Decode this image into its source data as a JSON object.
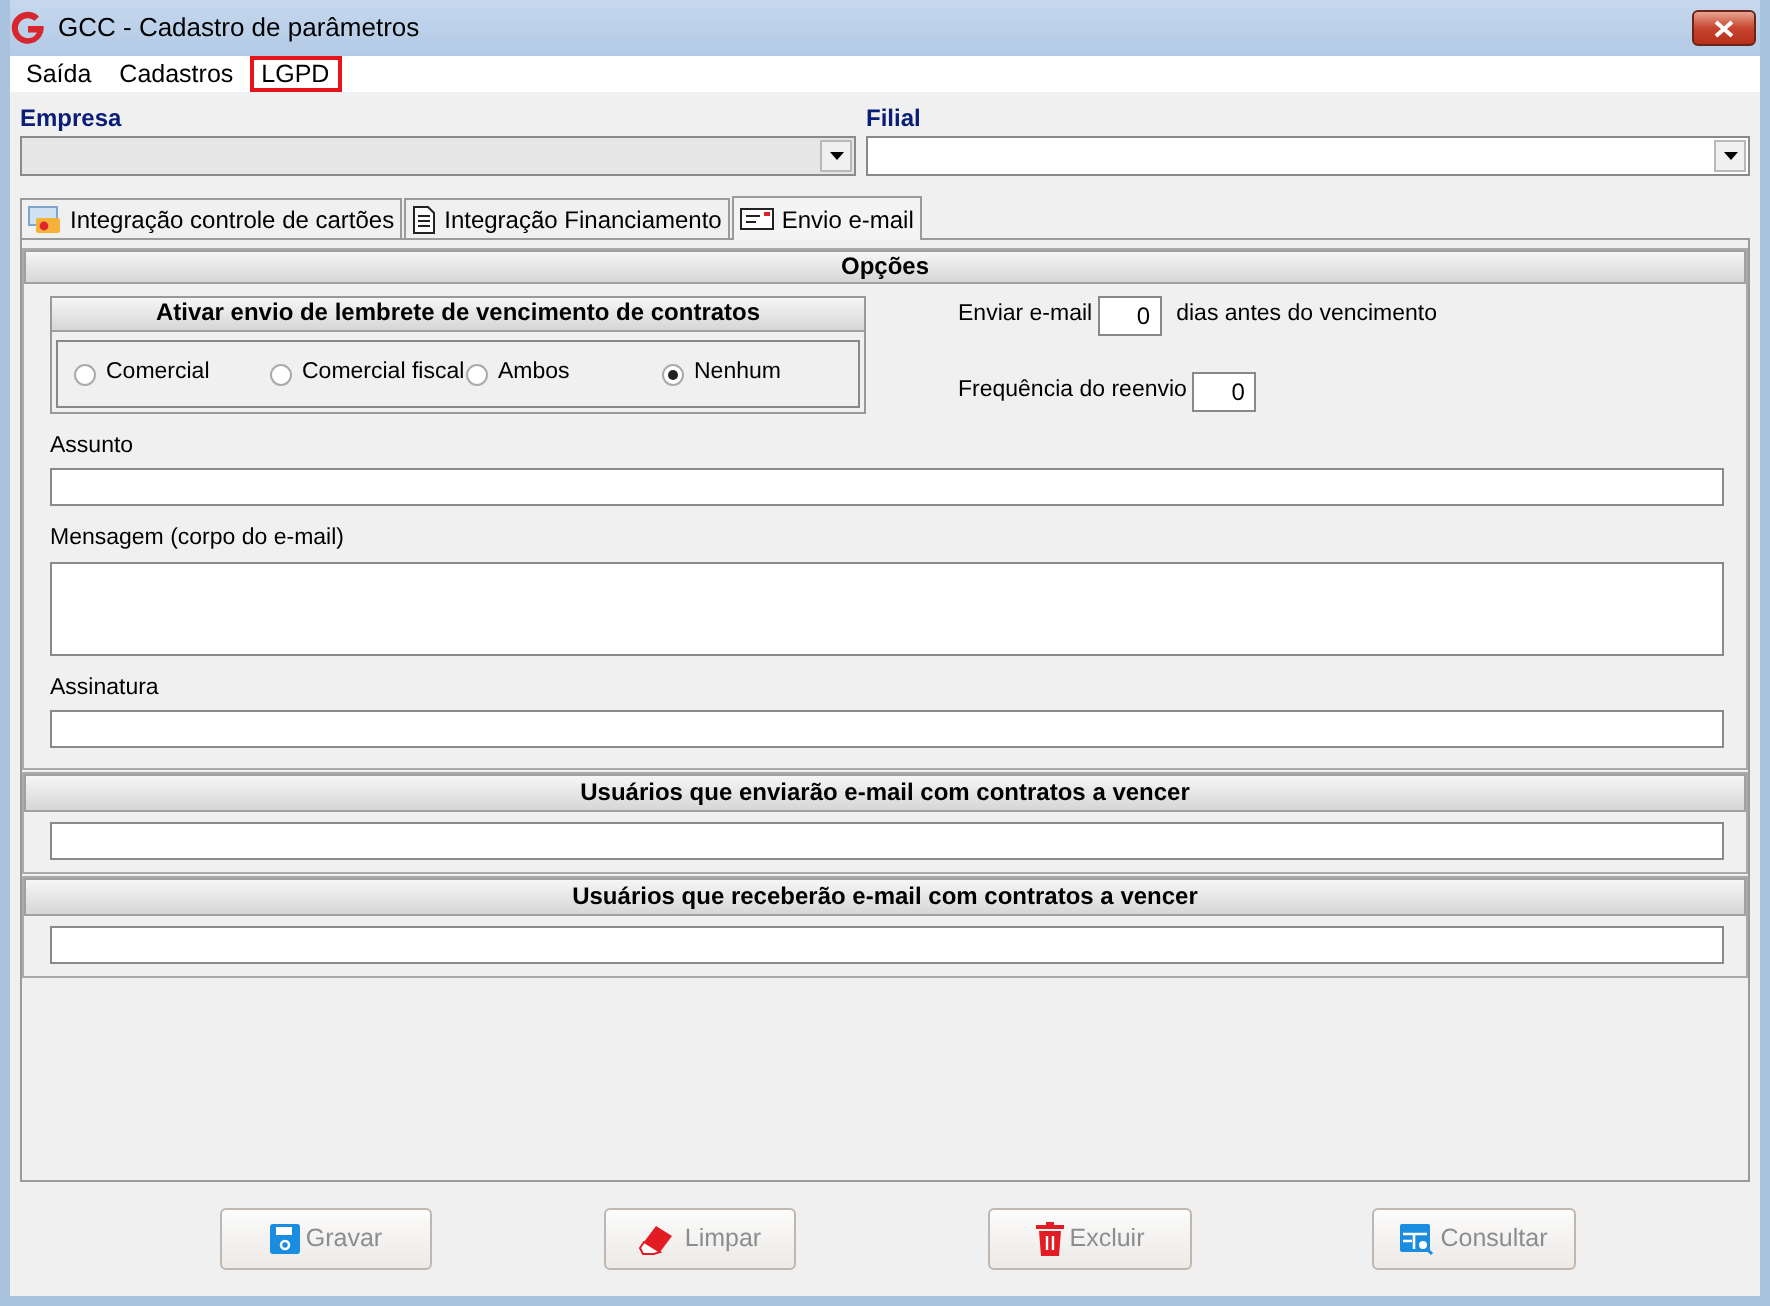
{
  "window": {
    "title": "GCC - Cadastro de parâmetros"
  },
  "menu": [
    {
      "label": "Saída",
      "highlighted": false
    },
    {
      "label": "Cadastros",
      "highlighted": false
    },
    {
      "label": "LGPD",
      "highlighted": true
    }
  ],
  "empresa": {
    "label": "Empresa",
    "disabled": true
  },
  "filial": {
    "label": "Filial",
    "disabled": false
  },
  "tabs": [
    {
      "label": "Integração controle de cartões",
      "selected": false
    },
    {
      "label": "Integração Financiamento",
      "selected": false
    },
    {
      "label": "Envio e-mail",
      "selected": true
    }
  ],
  "options": {
    "title": "Opções",
    "reminder": {
      "title": "Ativar envio de lembrete de vencimento de contratos",
      "choices": [
        {
          "label": "Comercial",
          "selected": false
        },
        {
          "label": "Comercial fiscal",
          "selected": false
        },
        {
          "label": "Ambos",
          "selected": false
        },
        {
          "label": "Nenhum",
          "selected": true
        }
      ]
    },
    "send_days": {
      "label": "Enviar e-mail",
      "value": "0",
      "suffix": "dias antes do vencimento"
    },
    "resend": {
      "label": "Frequência do reenvio",
      "value": "0"
    },
    "fields": [
      {
        "label": "Assunto",
        "kind": "line"
      },
      {
        "label": "Mensagem (corpo do e-mail)",
        "kind": "multiline"
      },
      {
        "label": "Assinatura",
        "kind": "line"
      }
    ]
  },
  "sections": [
    {
      "title": "Usuários que enviarão e-mail com contratos a vencer"
    },
    {
      "title": "Usuários que receberão e-mail com contratos a vencer"
    }
  ],
  "buttons": [
    {
      "label": "Gravar",
      "disabled": true
    },
    {
      "label": "Limpar",
      "disabled": true
    },
    {
      "label": "Excluir",
      "disabled": true
    },
    {
      "label": "Consultar",
      "disabled": true
    }
  ]
}
